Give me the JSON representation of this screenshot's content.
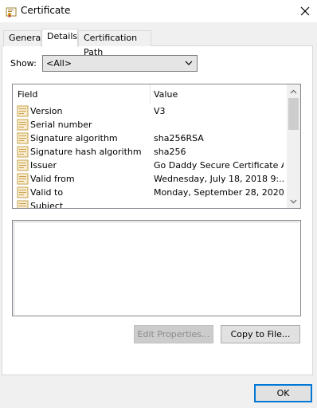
{
  "window": {
    "title": "Certificate",
    "icon": "certificate-icon",
    "close_icon": "close-icon"
  },
  "tabs": [
    {
      "label": "General",
      "active": false
    },
    {
      "label": "Details",
      "active": true
    },
    {
      "label": "Certification Path",
      "active": false
    }
  ],
  "show": {
    "label": "Show:",
    "value": "<All>"
  },
  "list": {
    "columns": [
      "Field",
      "Value"
    ],
    "rows": [
      {
        "field": "Version",
        "value": "V3"
      },
      {
        "field": "Serial number",
        "value": ""
      },
      {
        "field": "Signature algorithm",
        "value": "sha256RSA"
      },
      {
        "field": "Signature hash algorithm",
        "value": "sha256"
      },
      {
        "field": "Issuer",
        "value": "Go Daddy Secure Certificate A..."
      },
      {
        "field": "Valid from",
        "value": "Wednesday, July 18, 2018 9:..."
      },
      {
        "field": "Valid to",
        "value": "Monday, September 28, 2020 ..."
      },
      {
        "field": "Subject",
        "value": ""
      }
    ]
  },
  "buttons": {
    "edit_properties": "Edit Properties...",
    "copy_to_file": "Copy to File...",
    "ok": "OK"
  },
  "colors": {
    "accent": "#0078d7",
    "field_icon": "#c8a04a"
  }
}
